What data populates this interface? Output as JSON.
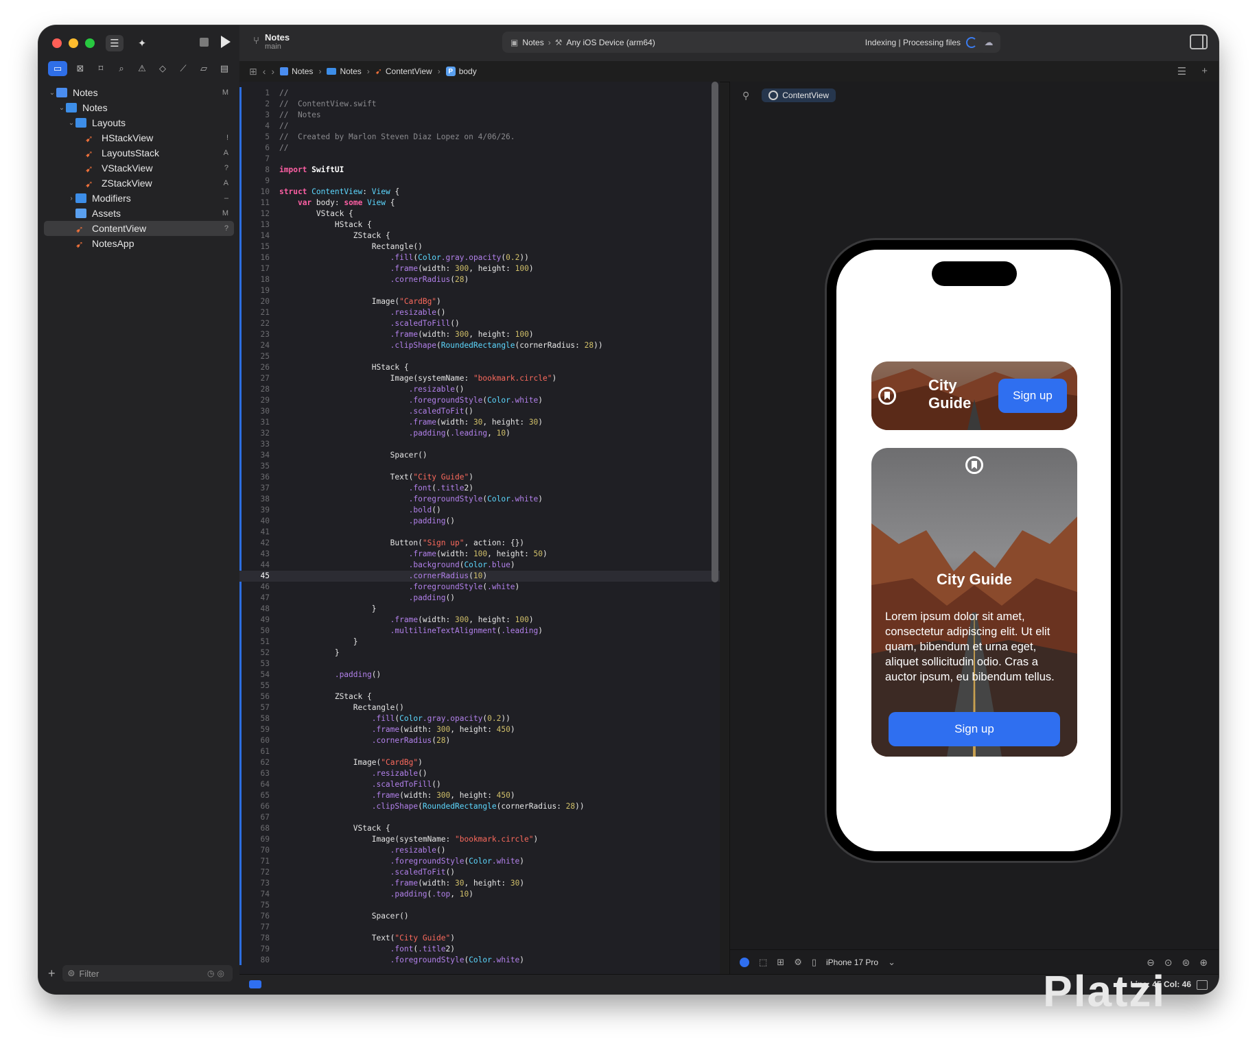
{
  "toolbar": {
    "project": "Notes",
    "branch": "main",
    "scheme": "Notes",
    "device": "Any iOS Device (arm64)",
    "status": "Indexing | Processing files"
  },
  "sidebar": {
    "tree": [
      {
        "label": "Notes",
        "badge": "M",
        "depth": 0,
        "kind": "project",
        "chev": "v"
      },
      {
        "label": "Notes",
        "badge": "",
        "depth": 1,
        "kind": "folder",
        "chev": "v"
      },
      {
        "label": "Layouts",
        "badge": "",
        "depth": 2,
        "kind": "folder",
        "chev": "v"
      },
      {
        "label": "HStackView",
        "badge": "!",
        "depth": 3,
        "kind": "swift",
        "chev": ""
      },
      {
        "label": "LayoutsStack",
        "badge": "A",
        "depth": 3,
        "kind": "swift",
        "chev": ""
      },
      {
        "label": "VStackView",
        "badge": "?",
        "depth": 3,
        "kind": "swift",
        "chev": ""
      },
      {
        "label": "ZStackView",
        "badge": "A",
        "depth": 3,
        "kind": "swift",
        "chev": ""
      },
      {
        "label": "Modifiers",
        "badge": "–",
        "depth": 2,
        "kind": "folder",
        "chev": ">"
      },
      {
        "label": "Assets",
        "badge": "M",
        "depth": 2,
        "kind": "assets",
        "chev": ""
      },
      {
        "label": "ContentView",
        "badge": "?",
        "depth": 2,
        "kind": "swift",
        "chev": "",
        "selected": true
      },
      {
        "label": "NotesApp",
        "badge": "",
        "depth": 2,
        "kind": "swift",
        "chev": ""
      }
    ],
    "filter_placeholder": "Filter"
  },
  "jumpbar": {
    "crumbs": [
      "Notes",
      "Notes",
      "ContentView",
      "body"
    ]
  },
  "editor": {
    "highlight_line": 45,
    "lines": [
      "//",
      "//  ContentView.swift",
      "//  Notes",
      "//",
      "//  Created by Marlon Steven Diaz Lopez on 4/06/26.",
      "//",
      "",
      "import SwiftUI",
      "",
      "struct ContentView: View {",
      "    var body: some View {",
      "        VStack {",
      "            HStack {",
      "                ZStack {",
      "                    Rectangle()",
      "                        .fill(Color.gray.opacity(0.2))",
      "                        .frame(width: 300, height: 100)",
      "                        .cornerRadius(28)",
      "",
      "                    Image(\"CardBg\")",
      "                        .resizable()",
      "                        .scaledToFill()",
      "                        .frame(width: 300, height: 100)",
      "                        .clipShape(RoundedRectangle(cornerRadius: 28))",
      "",
      "                    HStack {",
      "                        Image(systemName: \"bookmark.circle\")",
      "                            .resizable()",
      "                            .foregroundStyle(Color.white)",
      "                            .scaledToFit()",
      "                            .frame(width: 30, height: 30)",
      "                            .padding(.leading, 10)",
      "",
      "                        Spacer()",
      "",
      "                        Text(\"City Guide\")",
      "                            .font(.title2)",
      "                            .foregroundStyle(Color.white)",
      "                            .bold()",
      "                            .padding()",
      "",
      "                        Button(\"Sign up\", action: {})",
      "                            .frame(width: 100, height: 50)",
      "                            .background(Color.blue)",
      "                            .cornerRadius(10)",
      "                            .foregroundStyle(.white)",
      "                            .padding()",
      "                    }",
      "                        .frame(width: 300, height: 100)",
      "                        .multilineTextAlignment(.leading)",
      "                }",
      "            }",
      "",
      "            .padding()",
      "",
      "            ZStack {",
      "                Rectangle()",
      "                    .fill(Color.gray.opacity(0.2))",
      "                    .frame(width: 300, height: 450)",
      "                    .cornerRadius(28)",
      "",
      "                Image(\"CardBg\")",
      "                    .resizable()",
      "                    .scaledToFill()",
      "                    .frame(width: 300, height: 450)",
      "                    .clipShape(RoundedRectangle(cornerRadius: 28))",
      "",
      "                VStack {",
      "                    Image(systemName: \"bookmark.circle\")",
      "                        .resizable()",
      "                        .foregroundStyle(Color.white)",
      "                        .scaledToFit()",
      "                        .frame(width: 30, height: 30)",
      "                        .padding(.top, 10)",
      "",
      "                    Spacer()",
      "",
      "                    Text(\"City Guide\")",
      "                        .font(.title2)",
      "                        .foregroundStyle(Color.white)"
    ]
  },
  "canvas": {
    "tab": "ContentView",
    "device": "iPhone 17 Pro",
    "card_small": {
      "title": "City Guide",
      "button": "Sign up"
    },
    "card_large": {
      "title": "City Guide",
      "body": "Lorem ipsum dolor sit amet, consectetur adipiscing elit. Ut elit quam, bibendum et urna eget, aliquet sollicitudin odio. Cras a auctor ipsum, eu bibendum tellus.",
      "button": "Sign up"
    }
  },
  "statusbar": {
    "position": "Line: 45  Col: 46"
  },
  "watermark": "Platzi",
  "colors": {
    "accent": "#2f6ff0",
    "keyword": "#fc5fa3",
    "type": "#5dd8ff",
    "string": "#fc6a5d",
    "number": "#d0bf69",
    "method": "#b281eb"
  }
}
